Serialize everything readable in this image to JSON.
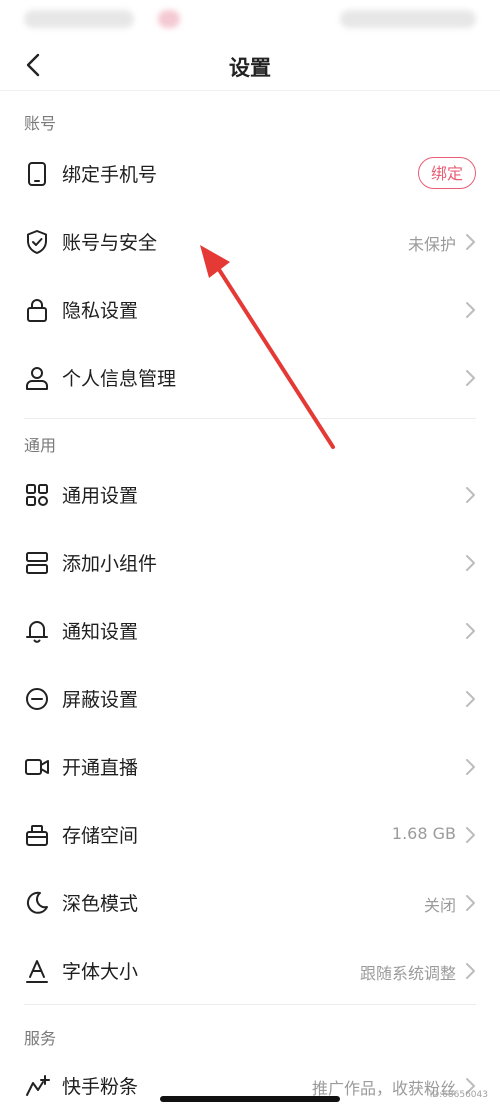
{
  "header": {
    "title": "设置"
  },
  "sections": {
    "account": "账号",
    "general": "通用",
    "service": "服务"
  },
  "rows": {
    "phone": {
      "label": "绑定手机号",
      "button": "绑定"
    },
    "security": {
      "label": "账号与安全",
      "value": "未保护"
    },
    "privacy": {
      "label": "隐私设置"
    },
    "personal": {
      "label": "个人信息管理"
    },
    "general": {
      "label": "通用设置"
    },
    "widget": {
      "label": "添加小组件"
    },
    "notify": {
      "label": "通知设置"
    },
    "block": {
      "label": "屏蔽设置"
    },
    "live": {
      "label": "开通直播"
    },
    "storage": {
      "label": "存储空间",
      "value": "1.68 GB"
    },
    "dark": {
      "label": "深色模式",
      "value": "关闭"
    },
    "font": {
      "label": "字体大小",
      "value": "跟随系统调整"
    },
    "fans": {
      "label": "快手粉条",
      "value": "推广作品，收获粉丝"
    }
  },
  "colors": {
    "accent": "#e85d75",
    "annotation_arrow": "#e53935"
  },
  "watermark": "ID:68656043"
}
